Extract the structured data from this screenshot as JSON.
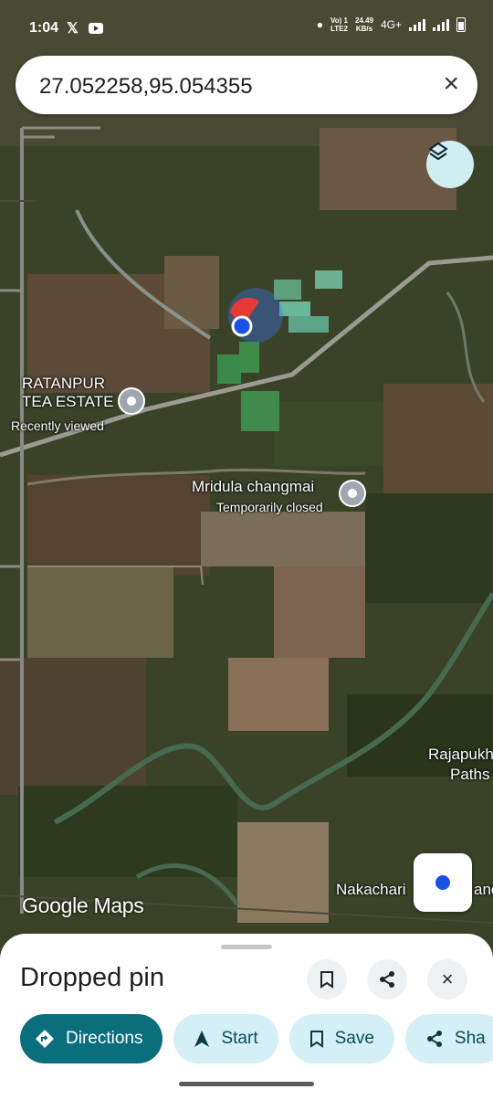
{
  "status_bar": {
    "time": "1:04",
    "net_label_top": "Vo) 1",
    "net_label_bottom": "LTE2",
    "speed_top": "24.49",
    "speed_bottom": "KB/s",
    "network": "4G+"
  },
  "search": {
    "query": "27.052258,95.054355"
  },
  "map": {
    "places": [
      {
        "name_line1": "RATANPUR",
        "name_line2": "TEA ESTATE",
        "note": "Recently viewed"
      },
      {
        "name_line1": "Mridula changmai",
        "note": "Temporarily closed"
      }
    ],
    "edge_labels": [
      "Rajapukh",
      "Paths",
      "Nakachari"
    ],
    "partial_label": "and",
    "attribution": "Google Maps",
    "icons": [
      "layers-icon",
      "my-location-icon",
      "place-pin-icon",
      "lock-pin-icon"
    ]
  },
  "sheet": {
    "title": "Dropped pin",
    "actions": [
      {
        "label": "Directions",
        "icon": "directions-icon"
      },
      {
        "label": "Start",
        "icon": "navigation-arrow-icon"
      },
      {
        "label": "Save",
        "icon": "bookmark-icon"
      },
      {
        "label": "Sha",
        "icon": "share-icon"
      }
    ]
  },
  "colors": {
    "primary": "#0a6e7d",
    "chip": "#d4eff6",
    "location_dot": "#1a52e6",
    "pin_red": "#e53935"
  }
}
